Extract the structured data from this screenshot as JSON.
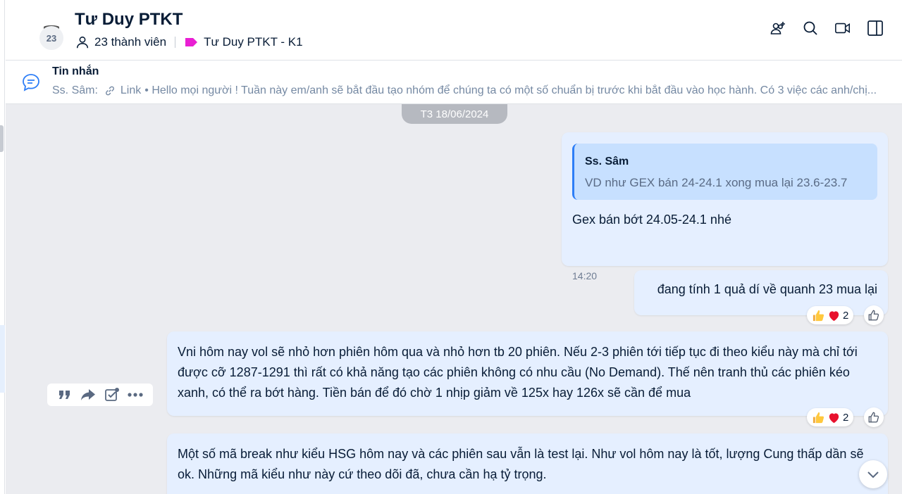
{
  "header": {
    "group_name": "Tư Duy PTKT",
    "avatar_badge": "23",
    "member_count": "23 thành viên",
    "tag_label": "Tư Duy PTKT - K1",
    "tag_color": "#e91fd3",
    "icons": [
      "add-member-icon",
      "search-icon",
      "video-call-icon",
      "sidebar-toggle-icon"
    ]
  },
  "pinned": {
    "title": "Tin nhắn",
    "sender": "Ss. Sâm:",
    "link_label": "Link",
    "preview": "• Hello mọi người ! Tuần này em/anh sẽ bắt đầu tạo nhóm để chúng ta có một số chuẩn bị trước khi bắt đầu vào học hành. Có 3 việc các anh/chị..."
  },
  "chat": {
    "date_label": "T3 18/06/2024",
    "messages": [
      {
        "quote_name": "Ss. Sâm",
        "quote_text": "VD như GEX bán 24-24.1 xong mua lại 23.6-23.7",
        "text": "Gex bán bớt 24.05-24.1 nhé",
        "time": "14:20"
      },
      {
        "text": "đang tính 1 quả dí về quanh 23 mua lại",
        "reaction_count": "2"
      },
      {
        "text": "Vni hôm nay vol sẽ nhỏ hơn phiên hôm qua và nhỏ hơn tb 20 phiên. Nếu 2-3 phiên tới tiếp tục đi theo kiểu này mà chỉ tới được cỡ 1287-1291 thì rất có khả năng tạo các phiên không có nhu cầu (No Demand). Thế nên tranh thủ các phiên kéo xanh, có thể ra bớt hàng. Tiền bán để đó chờ 1 nhịp giảm về 125x hay 126x sẽ cần để mua",
        "reaction_count": "2"
      },
      {
        "text": "Một số mã break như kiểu HSG hôm nay và các phiên sau vẫn là test lại. Như vol hôm nay là tốt, lượng Cung thấp dần sẽ ok. Những mã kiểu như này cứ theo dõi đã, chưa cần hạ tỷ trọng."
      }
    ]
  },
  "colors": {
    "accent": "#2d7ef7",
    "bubble": "#e5efff",
    "quote": "#c7e0ff",
    "chat_bg": "#ebecf0"
  }
}
